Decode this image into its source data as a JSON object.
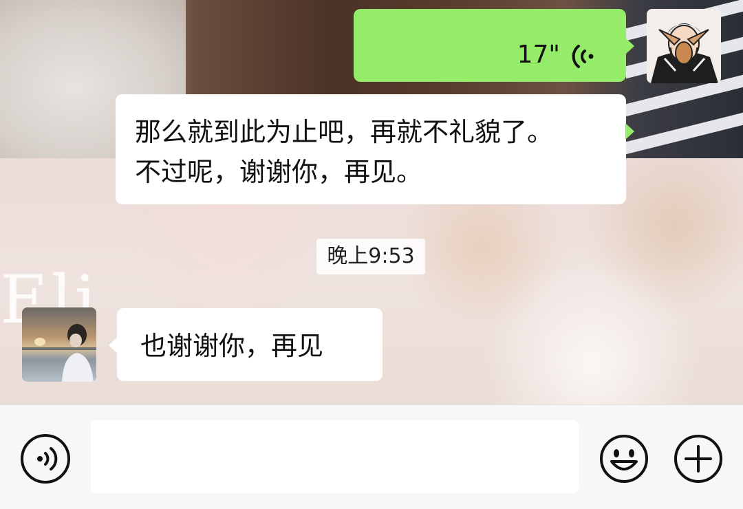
{
  "messages": [
    {
      "sender": "self",
      "type": "voice",
      "duration": "17\"",
      "icon": "voice-wave-icon"
    },
    {
      "sender": "self",
      "type": "text",
      "lines": [
        "那么就到此为止吧，再就不礼貌了。",
        "不过呢，谢谢你，再见。"
      ]
    },
    {
      "type": "timestamp",
      "text": "晚上9:53"
    },
    {
      "sender": "peer",
      "type": "text",
      "lines": [
        "也谢谢你，再见"
      ]
    }
  ],
  "background_text": "Eli",
  "input_bar": {
    "voice_icon": "voice-toggle-icon",
    "input_value": "",
    "emoji_icon": "emoji-icon",
    "add_icon": "add-icon"
  },
  "colors": {
    "outgoing_bubble": "#95ec69",
    "incoming_bubble": "#ffffff",
    "input_bar_bg": "#f7f7f7"
  }
}
